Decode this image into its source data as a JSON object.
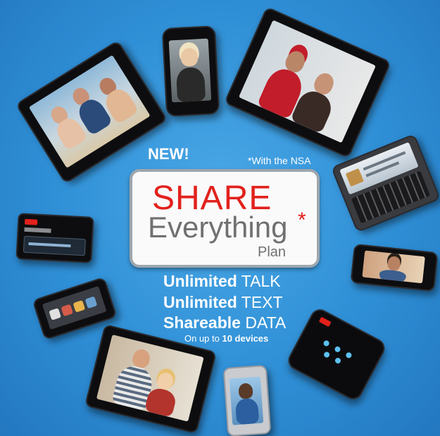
{
  "badge": "NEW!",
  "footnote": "*With the NSA",
  "logo": {
    "share": "SHARE",
    "everything": "Everything",
    "asterisk": "*",
    "plan": "Plan"
  },
  "features": [
    {
      "bold": "Unlimited",
      "light": "TALK"
    },
    {
      "bold": "Unlimited",
      "light": "TEXT"
    },
    {
      "bold": "Shareable",
      "light": "DATA"
    }
  ],
  "devices_note": {
    "prefix": "On up to ",
    "count": "10 devices"
  },
  "devices": [
    "tablet-beach-group",
    "phone-blonde-woman",
    "tablet-graduates",
    "slider-qwerty-phone",
    "phone-man-portrait",
    "jetpack-hotspot-square",
    "phone-man-smiling",
    "tablet-couple",
    "phone-app-icons",
    "jetpack-hotspot-wide"
  ],
  "colors": {
    "background": "#2f8fd6",
    "brand_red": "#e2211c",
    "logo_gray": "#707070"
  }
}
